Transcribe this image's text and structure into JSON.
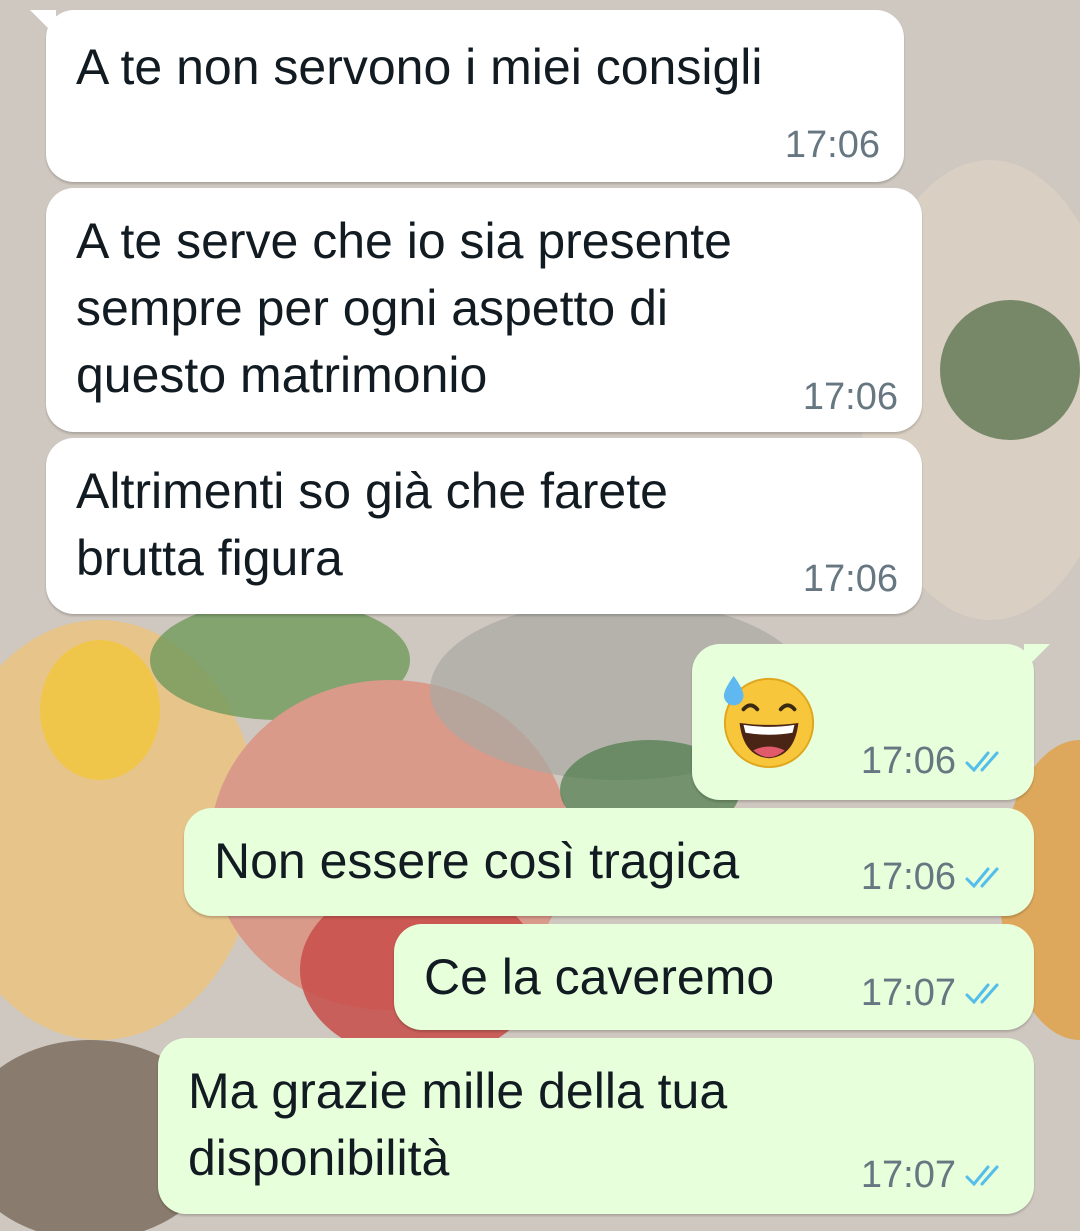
{
  "chat": {
    "messages": [
      {
        "direction": "incoming",
        "lines": [
          "A te non servono i miei consigli"
        ],
        "time": "17:06"
      },
      {
        "direction": "incoming",
        "lines": [
          "A te serve che io sia presente",
          "sempre per ogni aspetto di",
          "questo matrimonio"
        ],
        "time": "17:06"
      },
      {
        "direction": "incoming",
        "lines": [
          "Altrimenti so già che farete",
          "brutta figura"
        ],
        "time": "17:06"
      },
      {
        "direction": "outgoing",
        "emoji": "grinning-face-with-sweat",
        "time": "17:06",
        "status": "read"
      },
      {
        "direction": "outgoing",
        "lines": [
          "Non essere così tragica"
        ],
        "time": "17:06",
        "status": "read"
      },
      {
        "direction": "outgoing",
        "lines": [
          "Ce la caveremo"
        ],
        "time": "17:07",
        "status": "read"
      },
      {
        "direction": "outgoing",
        "lines": [
          "Ma grazie mille della tua",
          "disponibilità"
        ],
        "time": "17:07",
        "status": "read"
      }
    ]
  },
  "colors": {
    "incoming_bubble": "#ffffff",
    "outgoing_bubble": "#e7ffdb",
    "timestamp": "#667781",
    "read_ticks": "#53bdeb"
  }
}
